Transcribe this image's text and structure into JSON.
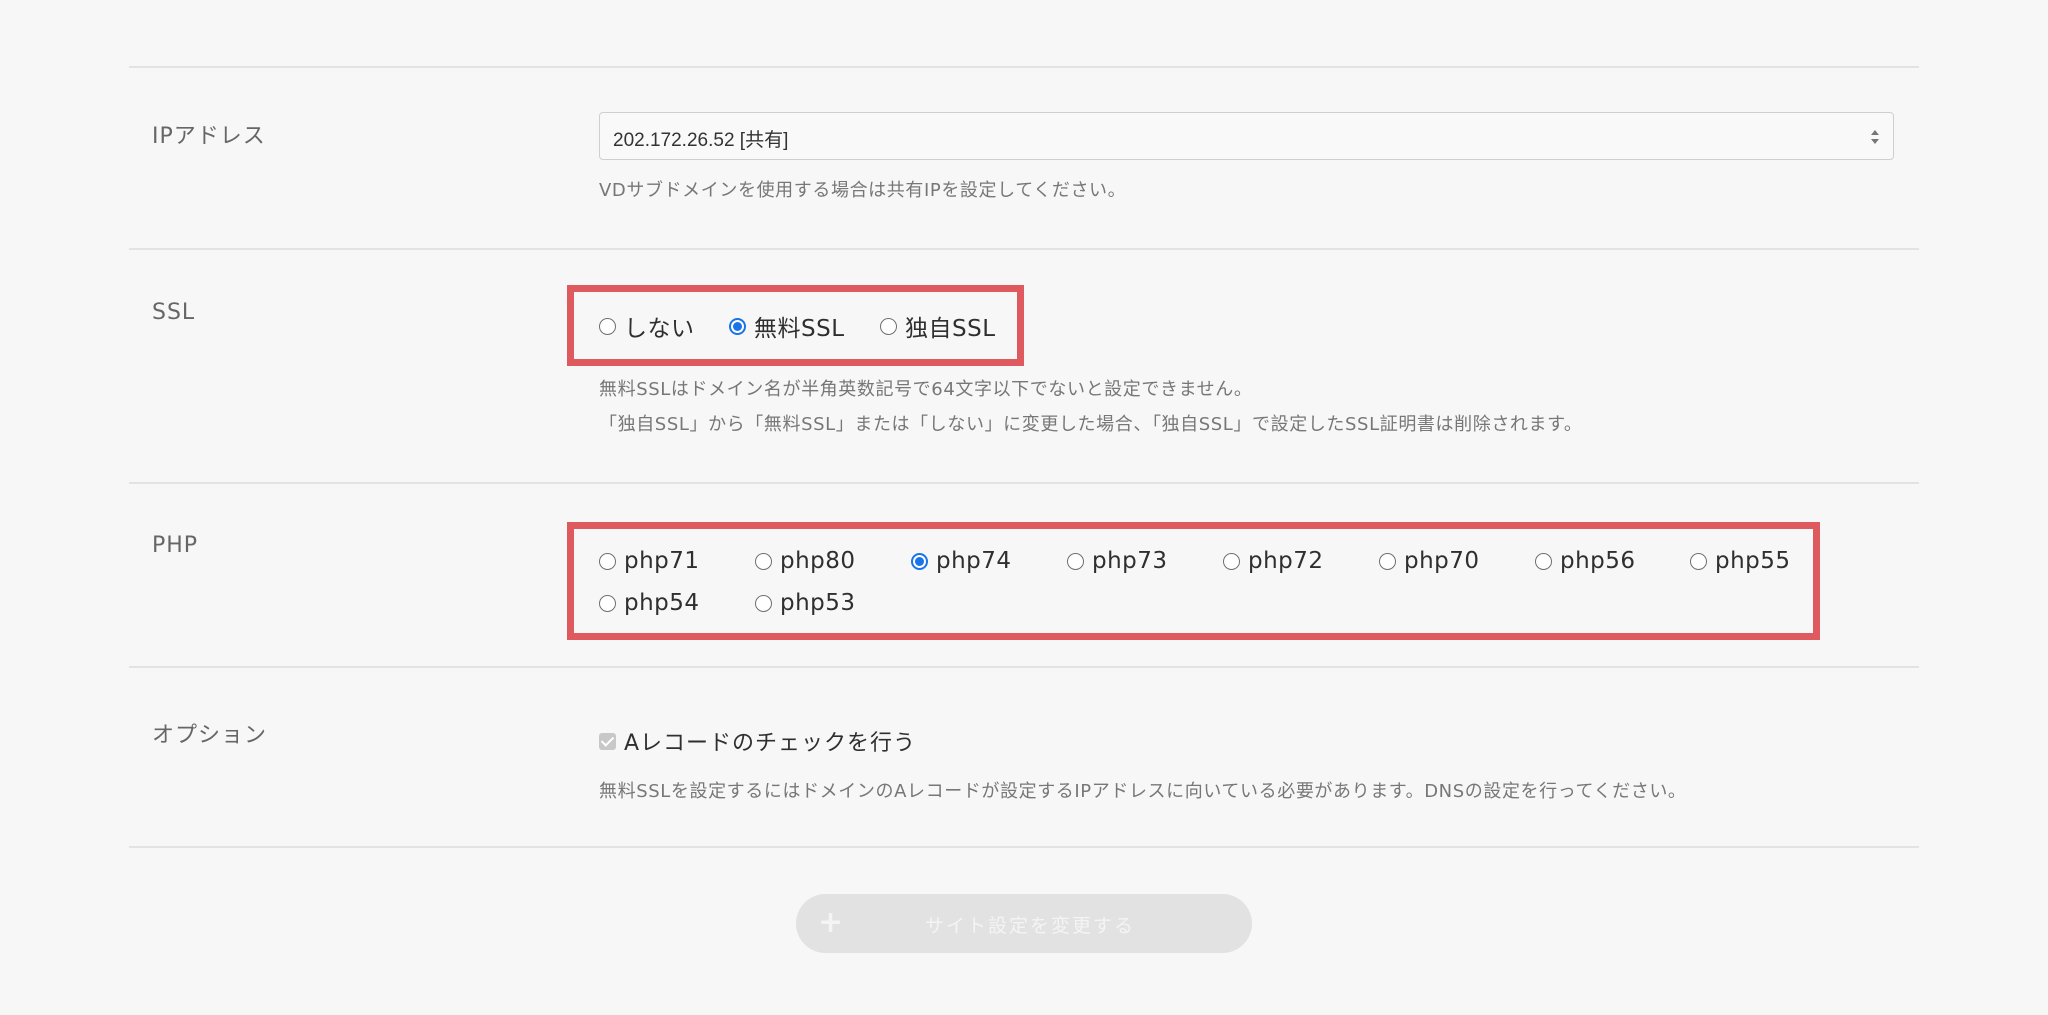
{
  "ip": {
    "label": "IPアドレス",
    "selected": "202.172.26.52 [共有]",
    "help": "VDサブドメインを使用する場合は共有IPを設定してください。"
  },
  "ssl": {
    "label": "SSL",
    "options": [
      "しない",
      "無料SSL",
      "独自SSL"
    ],
    "selected": "無料SSL",
    "help1": "無料SSLはドメイン名が半角英数記号で64文字以下でないと設定できません。",
    "help2": "「独自SSL」から「無料SSL」または「しない」に変更した場合、「独自SSL」で設定したSSL証明書は削除されます。"
  },
  "php": {
    "label": "PHP",
    "options": [
      "php71",
      "php80",
      "php74",
      "php73",
      "php72",
      "php70",
      "php56",
      "php55",
      "php54",
      "php53"
    ],
    "selected": "php74"
  },
  "option": {
    "label": "オプション",
    "checkbox_label": "Aレコードのチェックを行う",
    "checked": true,
    "help": "無料SSLを設定するにはドメインのAレコードが設定するIPアドレスに向いている必要があります。DNSの設定を行ってください。"
  },
  "submit": {
    "icon": "+",
    "label": "サイト設定を変更する"
  },
  "colors": {
    "highlight": "#de5a5f",
    "radio_checked": "#1a73e8"
  }
}
